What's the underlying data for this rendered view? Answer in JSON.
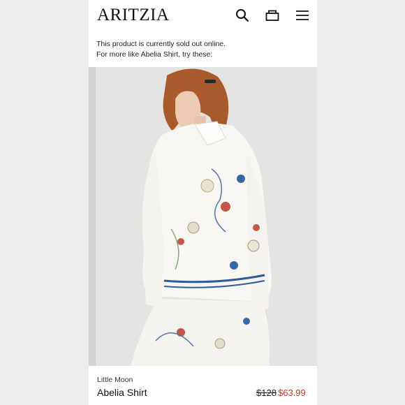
{
  "header": {
    "logo": "ARITZIA",
    "icons": [
      "search-icon",
      "bag-icon",
      "menu-icon"
    ]
  },
  "notice": {
    "line1": "This product is currently sold out online.",
    "line2": "For more like Abelia Shirt, try these:"
  },
  "product": {
    "brand": "Little Moon",
    "name": "Abelia Shirt",
    "original_price": "$128",
    "sale_price": "$63.99"
  },
  "colors": {
    "sale_price": "#c0392b",
    "stripe_blue": "#2f5a9e"
  }
}
